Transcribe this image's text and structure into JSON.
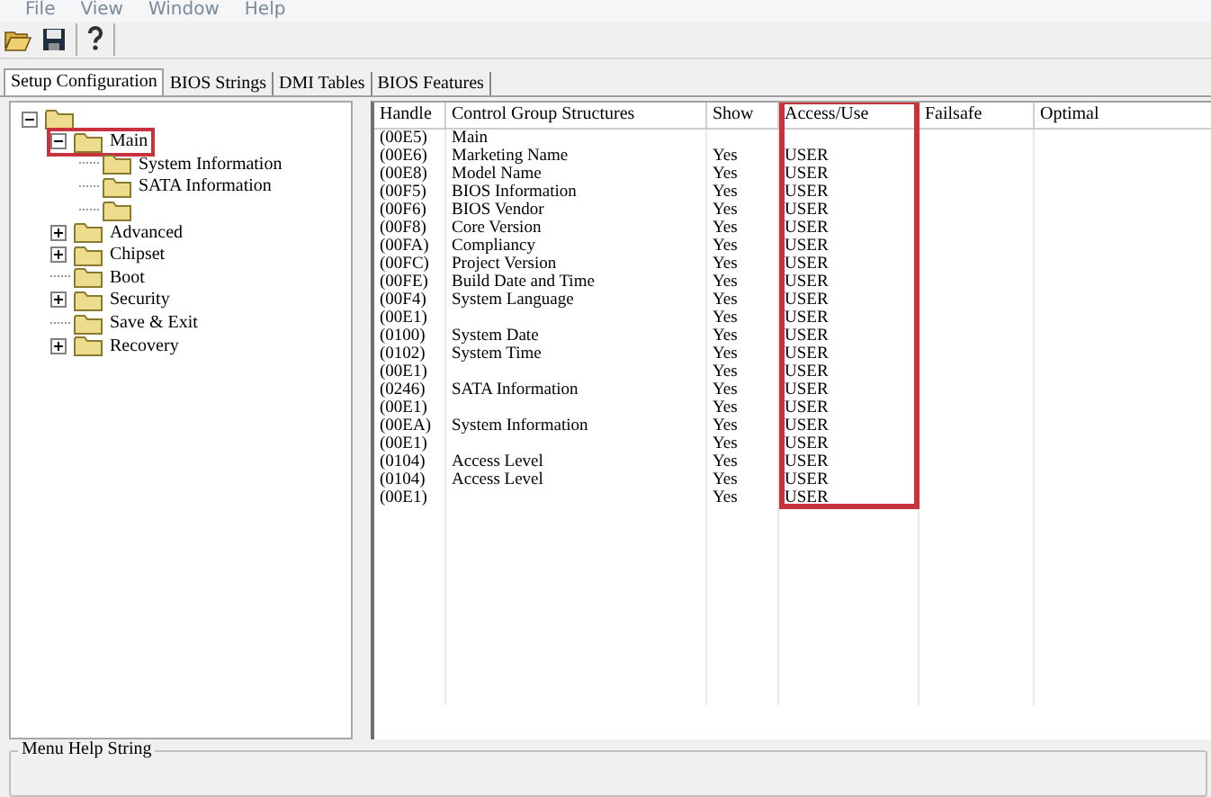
{
  "menu_bar": [
    "File",
    "View",
    "Window",
    "Help"
  ],
  "tabs": [
    {
      "label": "Setup Configuration",
      "selected": true
    },
    {
      "label": "BIOS Strings",
      "selected": false
    },
    {
      "label": "DMI Tables",
      "selected": false
    },
    {
      "label": "BIOS Features",
      "selected": false
    }
  ],
  "tree": [
    {
      "expanded": true,
      "highlighted": false,
      "children": [
        {
          "label": "Main",
          "expanded": true,
          "highlighted": true,
          "children": [
            {
              "label": "System Information",
              "highlighted": false
            },
            {
              "label": "SATA Information",
              "highlighted": false
            },
            {
              "highlighted": false
            }
          ]
        },
        {
          "label": "Advanced",
          "expanded": false,
          "highlighted": false
        },
        {
          "label": "Chipset",
          "expanded": false,
          "highlighted": false
        },
        {
          "label": "Boot",
          "highlighted": false
        },
        {
          "label": "Security",
          "expanded": false,
          "highlighted": false
        },
        {
          "label": "Save & Exit",
          "highlighted": false
        },
        {
          "label": "Recovery",
          "expanded": false,
          "highlighted": false
        }
      ]
    }
  ],
  "table": {
    "columns": [
      {
        "label": "Handle",
        "highlighted": false
      },
      {
        "label": "Control Group Structures",
        "highlighted": false
      },
      {
        "label": "Show",
        "highlighted": false
      },
      {
        "label": "Access/Use",
        "highlighted": true
      },
      {
        "label": "Failsafe",
        "highlighted": false
      },
      {
        "label": "Optimal",
        "highlighted": false
      }
    ],
    "rows": [
      [
        "(00E5)",
        "Main",
        "",
        ""
      ],
      [
        "(00E6)",
        "Marketing Name",
        "Yes",
        "USER"
      ],
      [
        "(00E8)",
        "Model Name",
        "Yes",
        "USER"
      ],
      [
        "(00F5)",
        "BIOS Information",
        "Yes",
        "USER"
      ],
      [
        "(00F6)",
        "BIOS Vendor",
        "Yes",
        "USER"
      ],
      [
        "(00F8)",
        "Core Version",
        "Yes",
        "USER"
      ],
      [
        "(00FA)",
        "Compliancy",
        "Yes",
        "USER"
      ],
      [
        "(00FC)",
        "Project Version",
        "Yes",
        "USER"
      ],
      [
        "(00FE)",
        "Build Date and Time",
        "Yes",
        "USER"
      ],
      [
        "(00F4)",
        "System Language",
        "Yes",
        "USER"
      ],
      [
        "(00E1)",
        "",
        "Yes",
        "USER"
      ],
      [
        "(0100)",
        "System Date",
        "Yes",
        "USER"
      ],
      [
        "(0102)",
        "System Time",
        "Yes",
        "USER"
      ],
      [
        "(00E1)",
        "",
        "Yes",
        "USER"
      ],
      [
        "(0246)",
        "SATA Information",
        "Yes",
        "USER"
      ],
      [
        "(00E1)",
        "",
        "Yes",
        "USER"
      ],
      [
        "(00EA)",
        "System Information",
        "Yes",
        "USER"
      ],
      [
        "(00E1)",
        "",
        "Yes",
        "USER"
      ],
      [
        "(0104)",
        "Access Level",
        "Yes",
        "USER"
      ],
      [
        "(0104)",
        "Access Level",
        "Yes",
        "USER"
      ],
      [
        "(00E1)",
        "",
        "Yes",
        "USER"
      ]
    ]
  },
  "help_group": {
    "title": "Menu Help String"
  }
}
